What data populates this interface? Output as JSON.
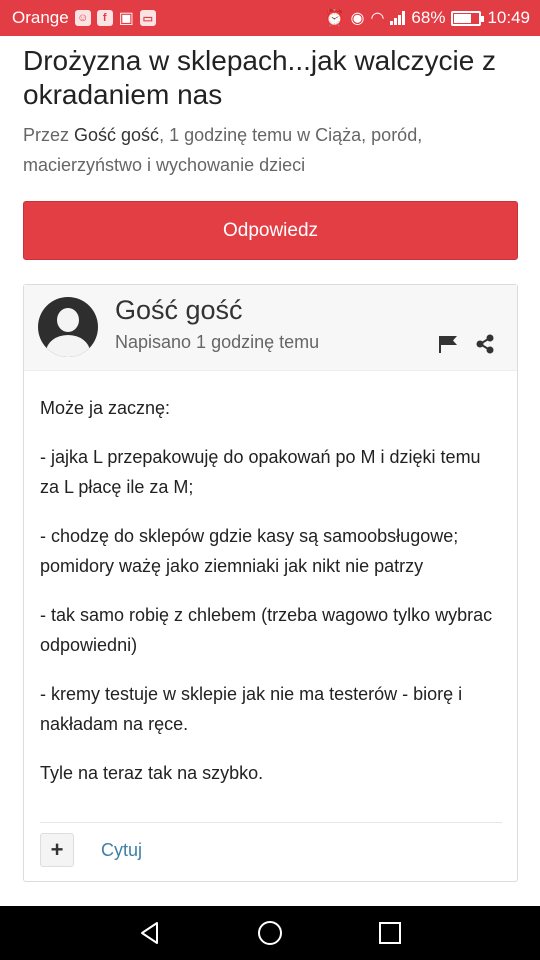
{
  "status_bar": {
    "carrier": "Orange",
    "battery_percent": "68%",
    "battery_level": 0.68,
    "time": "10:49",
    "background_color": "#e23c44"
  },
  "topic": {
    "title": "Drożyzna w sklepach...jak walczycie z okradaniem nas",
    "byline_prefix": "Przez ",
    "byline_author": "Gość gość",
    "byline_rest": ", 1 godzinę temu w Ciąża, poród, macierzyństwo i wychowanie dzieci"
  },
  "reply_button": {
    "label": "Odpowiedz",
    "color": "#e43e45"
  },
  "post": {
    "author": "Gość gość",
    "posted": "Napisano 1 godzinę temu",
    "paragraphs": [
      "Może ja zacznę:",
      "- jajka L przepakowuję do opakowań po M i dzięki temu za L płacę ile za M;",
      "- chodzę do sklepów gdzie kasy są samoobsługowe; pomidory ważę jako ziemniaki jak nikt nie patrzy",
      "- tak samo robię z chlebem (trzeba wagowo tylko wybrac odpowiedni)",
      "- kremy testuje w sklepie jak nie ma testerów - biorę i nakładam na ręce.",
      "Tyle na teraz tak na szybko."
    ],
    "plus_label": "+",
    "quote_label": "Cytuj",
    "link_color": "#3d7fa8"
  },
  "icons": {
    "flag": "flag-icon",
    "share": "share-icon",
    "back": "back-icon",
    "home": "home-icon",
    "recents": "recents-icon"
  }
}
